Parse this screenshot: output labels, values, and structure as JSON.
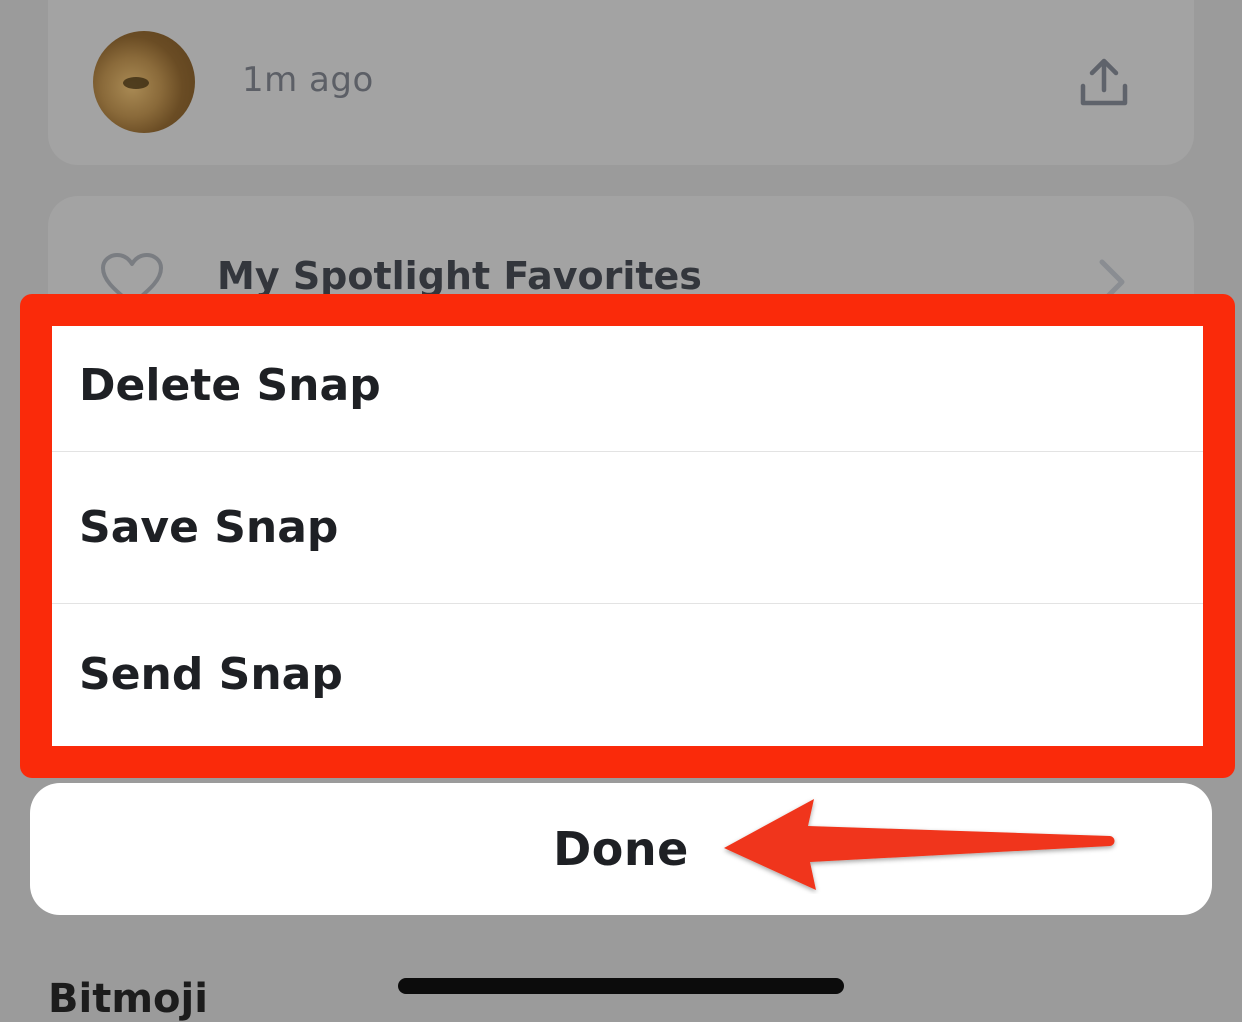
{
  "background": {
    "story": {
      "time_label": "1m ago"
    },
    "spotlight": {
      "label": "My Spotlight Favorites"
    },
    "section_heading": "Bitmoji"
  },
  "action_sheet": {
    "items": [
      {
        "label": "Delete Snap"
      },
      {
        "label": "Save Snap"
      },
      {
        "label": "Send Snap"
      }
    ],
    "done_label": "Done"
  },
  "colors": {
    "highlight": "#fa2a0a",
    "overlay": "#9b9b9b",
    "text": "#1e2024"
  },
  "icons": {
    "share": "share-icon",
    "heart": "heart-icon",
    "chevron": "chevron-right-icon",
    "annotation": "arrow-left-icon"
  }
}
